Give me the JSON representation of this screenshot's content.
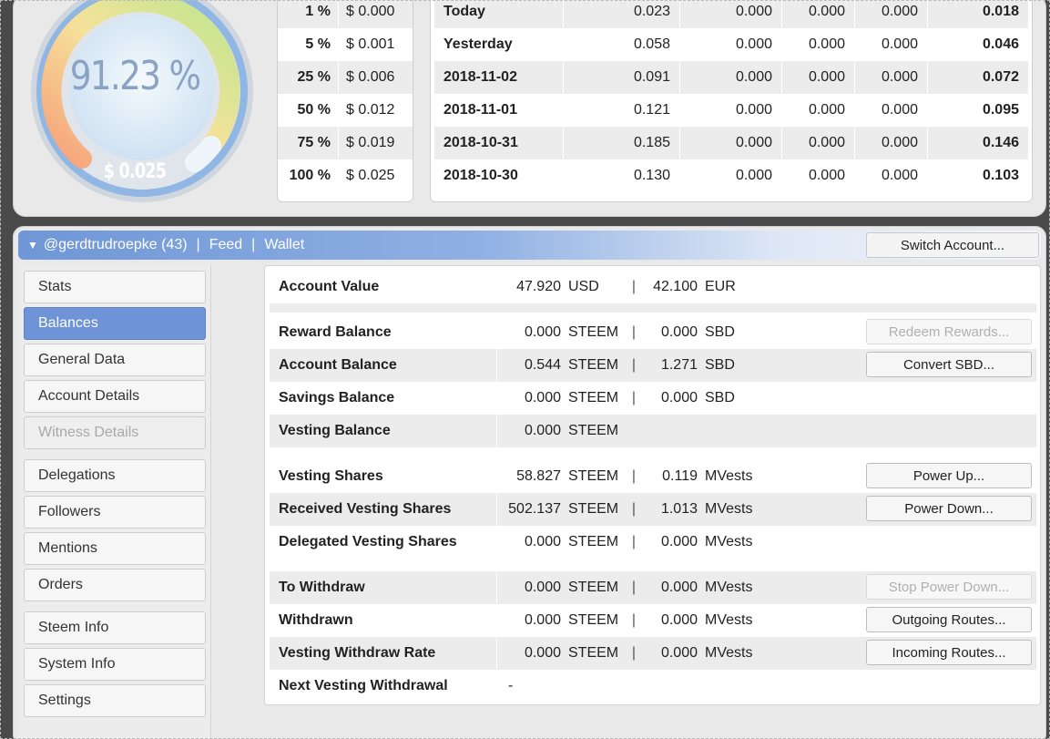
{
  "gauge": {
    "percent": "91.23 %",
    "value": "$ 0.025",
    "level": 0.9123,
    "colors": [
      "#f7a07a",
      "#f5e29a",
      "#bde68e",
      "#eaf4fa"
    ]
  },
  "percent_table": [
    {
      "p": "1 %",
      "v": "$ 0.000"
    },
    {
      "p": "5 %",
      "v": "$ 0.001"
    },
    {
      "p": "25 %",
      "v": "$ 0.006"
    },
    {
      "p": "50 %",
      "v": "$ 0.012"
    },
    {
      "p": "75 %",
      "v": "$ 0.019"
    },
    {
      "p": "100 %",
      "v": "$ 0.025"
    }
  ],
  "history": [
    {
      "d": "Today",
      "a": "0.023",
      "b": "0.000",
      "c": "0.000",
      "e": "0.000",
      "t": "0.018"
    },
    {
      "d": "Yesterday",
      "a": "0.058",
      "b": "0.000",
      "c": "0.000",
      "e": "0.000",
      "t": "0.046"
    },
    {
      "d": "2018-11-02",
      "a": "0.091",
      "b": "0.000",
      "c": "0.000",
      "e": "0.000",
      "t": "0.072"
    },
    {
      "d": "2018-11-01",
      "a": "0.121",
      "b": "0.000",
      "c": "0.000",
      "e": "0.000",
      "t": "0.095"
    },
    {
      "d": "2018-10-31",
      "a": "0.185",
      "b": "0.000",
      "c": "0.000",
      "e": "0.000",
      "t": "0.146"
    },
    {
      "d": "2018-10-30",
      "a": "0.130",
      "b": "0.000",
      "c": "0.000",
      "e": "0.000",
      "t": "0.103"
    }
  ],
  "titlebar": {
    "account": "@gerdtrudroepke (43)",
    "sep1": "|",
    "feed": "Feed",
    "sep2": "|",
    "wallet": "Wallet",
    "switch": "Switch Account..."
  },
  "sidebar": {
    "stats": "Stats",
    "balances": "Balances",
    "general": "General Data",
    "account_details": "Account Details",
    "witness": "Witness Details",
    "delegations": "Delegations",
    "followers": "Followers",
    "mentions": "Mentions",
    "orders": "Orders",
    "steem_info": "Steem Info",
    "system_info": "System Info",
    "settings": "Settings"
  },
  "balances": {
    "account_value": {
      "label": "Account Value",
      "n1": "47.920",
      "u1": "USD",
      "sep": "|",
      "n2": "42.100",
      "u2": "EUR"
    },
    "reward": {
      "label": "Reward Balance",
      "n1": "0.000",
      "u1": "STEEM",
      "sep": "|",
      "n2": "0.000",
      "u2": "SBD",
      "btn": "Redeem Rewards..."
    },
    "account": {
      "label": "Account Balance",
      "n1": "0.544",
      "u1": "STEEM",
      "sep": "|",
      "n2": "1.271",
      "u2": "SBD",
      "btn": "Convert SBD..."
    },
    "savings": {
      "label": "Savings Balance",
      "n1": "0.000",
      "u1": "STEEM",
      "sep": "|",
      "n2": "0.000",
      "u2": "SBD"
    },
    "vesting": {
      "label": "Vesting Balance",
      "n1": "0.000",
      "u1": "STEEM"
    },
    "vshares": {
      "label": "Vesting Shares",
      "n1": "58.827",
      "u1": "STEEM",
      "sep": "|",
      "n2": "0.119",
      "u2": "MVests",
      "btn": "Power Up..."
    },
    "received": {
      "label": "Received Vesting Shares",
      "n1": "502.137",
      "u1": "STEEM",
      "sep": "|",
      "n2": "1.013",
      "u2": "MVests",
      "btn": "Power Down..."
    },
    "delegated": {
      "label": "Delegated Vesting Shares",
      "n1": "0.000",
      "u1": "STEEM",
      "sep": "|",
      "n2": "0.000",
      "u2": "MVests"
    },
    "to_withdraw": {
      "label": "To Withdraw",
      "n1": "0.000",
      "u1": "STEEM",
      "sep": "|",
      "n2": "0.000",
      "u2": "MVests",
      "btn": "Stop Power Down..."
    },
    "withdrawn": {
      "label": "Withdrawn",
      "n1": "0.000",
      "u1": "STEEM",
      "sep": "|",
      "n2": "0.000",
      "u2": "MVests",
      "btn": "Outgoing Routes..."
    },
    "rate": {
      "label": "Vesting Withdraw Rate",
      "n1": "0.000",
      "u1": "STEEM",
      "sep": "|",
      "n2": "0.000",
      "u2": "MVests",
      "btn": "Incoming Routes..."
    },
    "next": {
      "label": "Next Vesting Withdrawal",
      "n1": "-"
    }
  }
}
